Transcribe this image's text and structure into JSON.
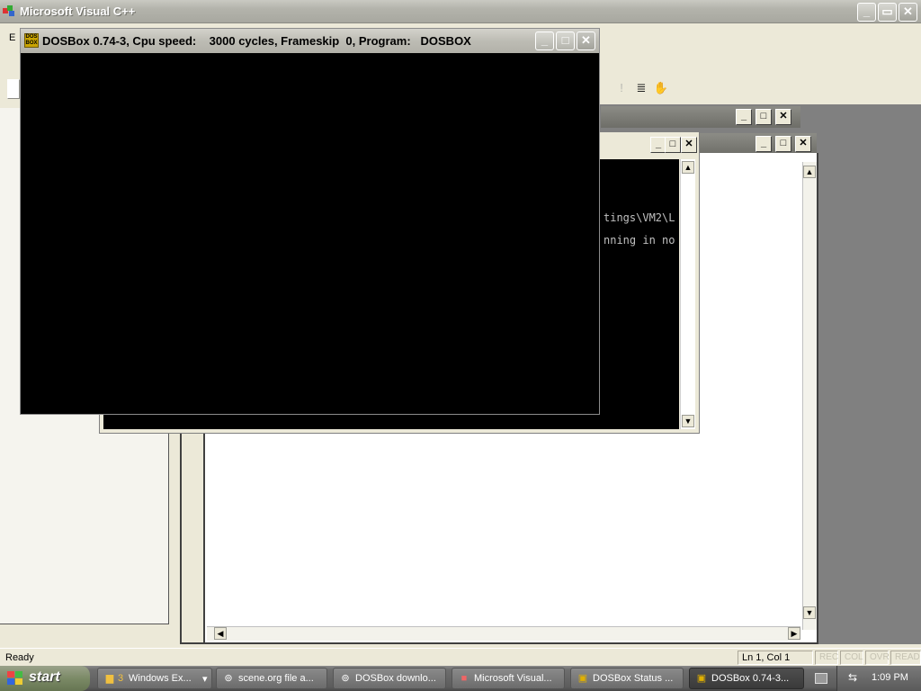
{
  "vc": {
    "title": "Microsoft Visual C++",
    "menu_first_letter": "E"
  },
  "dosbox": {
    "title": "DOSBox 0.74-3, Cpu speed:    3000 cycles, Frameskip  0, Program:   DOSBOX",
    "icon_text": "DOS BOX"
  },
  "console": {
    "lines": [
      "tings\\VM2\\L",
      "nning in no"
    ]
  },
  "statusbar": {
    "ready": "Ready",
    "position": "Ln 1, Col 1",
    "rec": "REC",
    "col": "COL",
    "ovr": "OVR",
    "read": "READ"
  },
  "taskbar": {
    "start": "start",
    "items": [
      {
        "count": "3",
        "label": "Windows Ex...",
        "icon": "folder-icon"
      },
      {
        "label": "scene.org file a...",
        "icon": "browser-icon"
      },
      {
        "label": "DOSBox downlo...",
        "icon": "browser-icon"
      },
      {
        "label": "Microsoft Visual...",
        "icon": "visual-cpp-icon"
      },
      {
        "label": "DOSBox Status ...",
        "icon": "dosbox-icon"
      },
      {
        "label": "DOSBox 0.74-3...",
        "icon": "dosbox-icon"
      }
    ],
    "clock": "1:09 PM"
  },
  "colors": {
    "titlebar_inactive": "#b3b3ab",
    "taskbar": "#5c5c5c",
    "dosbox_screen": "#000000"
  }
}
